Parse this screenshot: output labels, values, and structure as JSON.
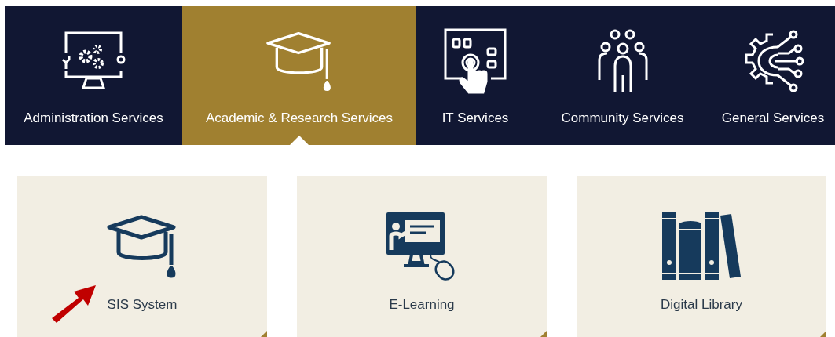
{
  "tabs": [
    {
      "label": "Administration Services",
      "kind": "monitor-gears",
      "selected": false
    },
    {
      "label": "Academic & Research Services",
      "kind": "cap",
      "selected": true
    },
    {
      "label": "IT Services",
      "kind": "touch",
      "selected": false
    },
    {
      "label": "Community Services",
      "kind": "people",
      "selected": false
    },
    {
      "label": "General Services",
      "kind": "circuit-gear",
      "selected": false
    }
  ],
  "cards": [
    {
      "label": "SIS System",
      "kind": "cap",
      "annotated": true
    },
    {
      "label": "E-Learning",
      "kind": "lesson",
      "annotated": false
    },
    {
      "label": "Digital Library",
      "kind": "books",
      "annotated": false
    }
  ]
}
